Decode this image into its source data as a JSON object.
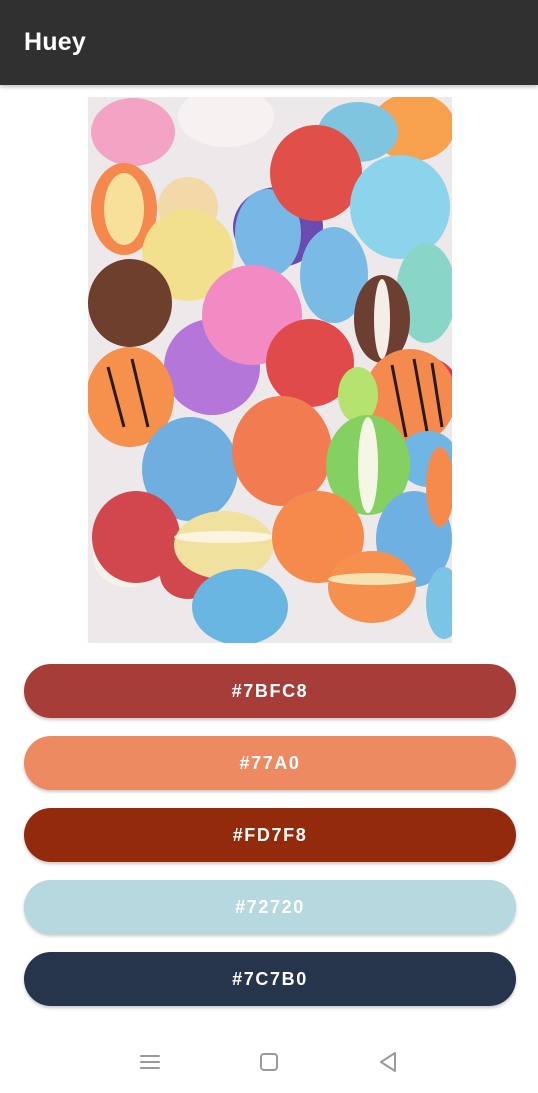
{
  "app": {
    "title": "Huey"
  },
  "image": {
    "description_icon": "macarons-photo-icon"
  },
  "swatches": [
    {
      "label": "#7BFC8",
      "color": "#a63d38",
      "text_color": "#ffffff"
    },
    {
      "label": "#77A0",
      "color": "#ee8a61",
      "text_color": "#ffffff"
    },
    {
      "label": "#FD7F8",
      "color": "#922a0b",
      "text_color": "#ffffff"
    },
    {
      "label": "#72720",
      "color": "#b6d8df",
      "text_color": "#ffffff"
    },
    {
      "label": "#7C7B0",
      "color": "#26344c",
      "text_color": "#ffffff"
    }
  ],
  "navbar": {
    "icons": [
      "recent-apps-icon",
      "home-icon",
      "back-icon"
    ]
  }
}
